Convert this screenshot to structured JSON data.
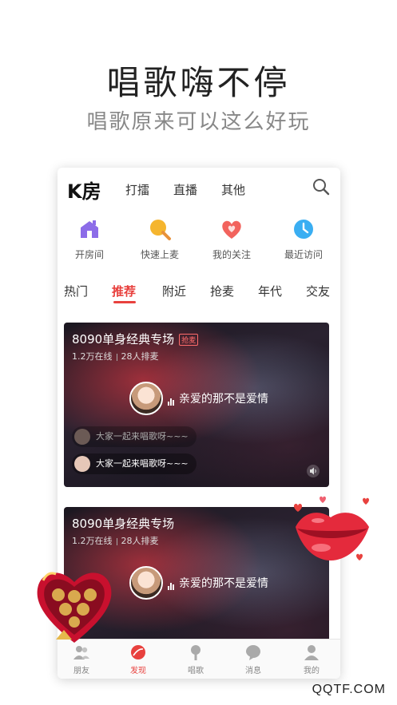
{
  "hero": {
    "headline": "唱歌嗨不停",
    "subline": "唱歌原来可以这么好玩"
  },
  "app": {
    "title": "K房",
    "top_tabs": [
      "打擂",
      "直播",
      "其他"
    ],
    "shortcuts": [
      {
        "label": "开房间",
        "icon": "house-icon",
        "color": "#8c6ce8"
      },
      {
        "label": "快速上麦",
        "icon": "mic-icon",
        "color": "#f5b52e"
      },
      {
        "label": "我的关注",
        "icon": "heart-icon",
        "color": "#f2635d"
      },
      {
        "label": "最近访问",
        "icon": "clock-icon",
        "color": "#3aaef2"
      }
    ],
    "categories": [
      "热门",
      "推荐",
      "附近",
      "抢麦",
      "年代",
      "交友"
    ],
    "active_category": "推荐",
    "accent": "#e8413e"
  },
  "rooms": [
    {
      "title": "8090单身经典专场",
      "badge": "抢麦",
      "online": "1.2万在线",
      "queue": "28人排麦",
      "song": "亲爱的那不是爱情",
      "chats": [
        "大家一起来唱歌呀~~~",
        "大家一起来唱歌呀~~~"
      ]
    },
    {
      "title": "8090单身经典专场",
      "badge": "",
      "online": "1.2万在线",
      "queue": "28人排麦",
      "song": "亲爱的那不是爱情",
      "chats": []
    }
  ],
  "bottom_nav": [
    {
      "label": "朋友",
      "icon": "friends-icon"
    },
    {
      "label": "发现",
      "icon": "discover-icon"
    },
    {
      "label": "唱歌",
      "icon": "mic-icon"
    },
    {
      "label": "消息",
      "icon": "message-icon"
    },
    {
      "label": "我的",
      "icon": "profile-icon"
    }
  ],
  "active_nav": "发现",
  "watermark": "QQTF.COM"
}
